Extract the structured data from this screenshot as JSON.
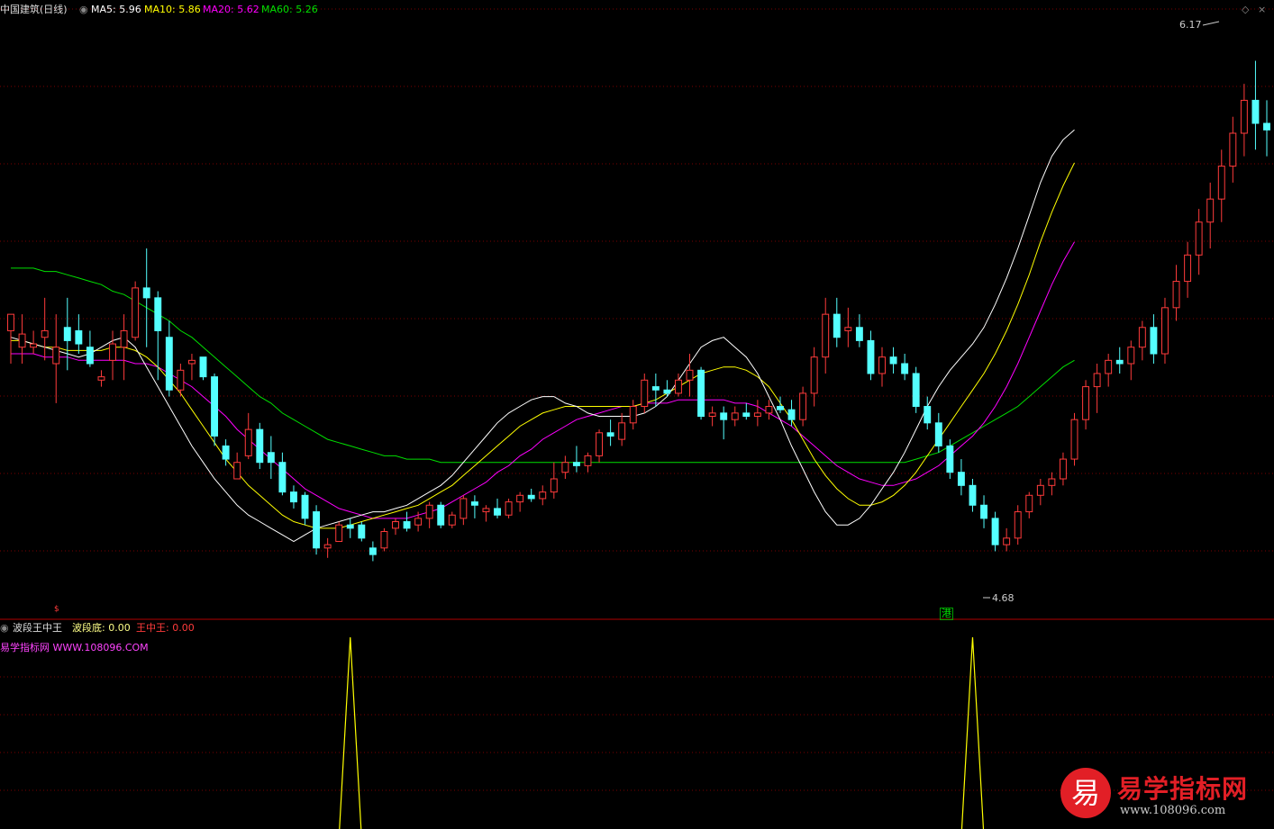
{
  "header": {
    "stock": "中国建筑(日线)",
    "ma5_label": "MA5:",
    "ma5_value": "5.96",
    "ma10_label": "MA10:",
    "ma10_value": "5.86",
    "ma20_label": "MA20:",
    "ma20_value": "5.62",
    "ma60_label": "MA60:",
    "ma60_value": "5.26"
  },
  "annotations": {
    "high": "6.17",
    "low": "4.68",
    "marker": "港"
  },
  "indicator": {
    "name": "波段王中王",
    "bottom_label": "波段底:",
    "bottom_value": "0.00",
    "king_label": "王中王:",
    "king_value": "0.00",
    "site": "易学指标网 WWW.108096.COM"
  },
  "watermark": {
    "logo": "易",
    "title": "易学指标网",
    "url": "www.108096.com"
  },
  "colors": {
    "up": "#ff3b3b",
    "down": "#54ffff",
    "ma5": "#ffffff",
    "ma10": "#ffff00",
    "ma20": "#ff00ff",
    "ma60": "#00e000",
    "grid": "#7a0000",
    "signal": "#ffff00"
  },
  "chart_data": {
    "type": "candlestick",
    "price_range": [
      4.55,
      6.3
    ],
    "grid": true,
    "candles": [
      {
        "o": 5.35,
        "h": 5.4,
        "l": 5.25,
        "c": 5.4
      },
      {
        "o": 5.3,
        "h": 5.4,
        "l": 5.25,
        "c": 5.34
      },
      {
        "o": 5.3,
        "h": 5.35,
        "l": 5.28,
        "c": 5.31
      },
      {
        "o": 5.33,
        "h": 5.45,
        "l": 5.26,
        "c": 5.35
      },
      {
        "o": 5.25,
        "h": 5.4,
        "l": 5.13,
        "c": 5.3
      },
      {
        "o": 5.36,
        "h": 5.45,
        "l": 5.23,
        "c": 5.32
      },
      {
        "o": 5.35,
        "h": 5.4,
        "l": 5.28,
        "c": 5.31
      },
      {
        "o": 5.3,
        "h": 5.35,
        "l": 5.24,
        "c": 5.25
      },
      {
        "o": 5.2,
        "h": 5.23,
        "l": 5.18,
        "c": 5.21
      },
      {
        "o": 5.26,
        "h": 5.35,
        "l": 5.2,
        "c": 5.31
      },
      {
        "o": 5.3,
        "h": 5.4,
        "l": 5.2,
        "c": 5.35
      },
      {
        "o": 5.33,
        "h": 5.5,
        "l": 5.32,
        "c": 5.48
      },
      {
        "o": 5.48,
        "h": 5.6,
        "l": 5.3,
        "c": 5.45
      },
      {
        "o": 5.45,
        "h": 5.47,
        "l": 5.2,
        "c": 5.35
      },
      {
        "o": 5.33,
        "h": 5.38,
        "l": 5.15,
        "c": 5.17
      },
      {
        "o": 5.17,
        "h": 5.25,
        "l": 5.15,
        "c": 5.23
      },
      {
        "o": 5.25,
        "h": 5.28,
        "l": 5.2,
        "c": 5.26
      },
      {
        "o": 5.27,
        "h": 5.27,
        "l": 5.2,
        "c": 5.21
      },
      {
        "o": 5.21,
        "h": 5.22,
        "l": 5,
        "c": 5.03
      },
      {
        "o": 5,
        "h": 5.02,
        "l": 4.94,
        "c": 4.96
      },
      {
        "o": 4.9,
        "h": 4.98,
        "l": 4.9,
        "c": 4.95
      },
      {
        "o": 4.97,
        "h": 5.1,
        "l": 4.96,
        "c": 5.05
      },
      {
        "o": 5.05,
        "h": 5.07,
        "l": 4.93,
        "c": 4.95
      },
      {
        "o": 4.98,
        "h": 5.03,
        "l": 4.9,
        "c": 4.95
      },
      {
        "o": 4.95,
        "h": 4.98,
        "l": 4.85,
        "c": 4.86
      },
      {
        "o": 4.86,
        "h": 4.88,
        "l": 4.81,
        "c": 4.83
      },
      {
        "o": 4.85,
        "h": 4.86,
        "l": 4.76,
        "c": 4.78
      },
      {
        "o": 4.8,
        "h": 4.82,
        "l": 4.67,
        "c": 4.69
      },
      {
        "o": 4.69,
        "h": 4.72,
        "l": 4.66,
        "c": 4.7
      },
      {
        "o": 4.71,
        "h": 4.77,
        "l": 4.71,
        "c": 4.76
      },
      {
        "o": 4.76,
        "h": 4.78,
        "l": 4.72,
        "c": 4.75
      },
      {
        "o": 4.76,
        "h": 4.77,
        "l": 4.71,
        "c": 4.72
      },
      {
        "o": 4.69,
        "h": 4.71,
        "l": 4.65,
        "c": 4.67
      },
      {
        "o": 4.69,
        "h": 4.75,
        "l": 4.68,
        "c": 4.74
      },
      {
        "o": 4.75,
        "h": 4.78,
        "l": 4.73,
        "c": 4.77
      },
      {
        "o": 4.77,
        "h": 4.8,
        "l": 4.74,
        "c": 4.75
      },
      {
        "o": 4.76,
        "h": 4.8,
        "l": 4.74,
        "c": 4.78
      },
      {
        "o": 4.78,
        "h": 4.83,
        "l": 4.75,
        "c": 4.82
      },
      {
        "o": 4.82,
        "h": 4.83,
        "l": 4.75,
        "c": 4.76
      },
      {
        "o": 4.76,
        "h": 4.8,
        "l": 4.75,
        "c": 4.79
      },
      {
        "o": 4.78,
        "h": 4.85,
        "l": 4.76,
        "c": 4.84
      },
      {
        "o": 4.83,
        "h": 4.85,
        "l": 4.78,
        "c": 4.82
      },
      {
        "o": 4.8,
        "h": 4.82,
        "l": 4.77,
        "c": 4.81
      },
      {
        "o": 4.81,
        "h": 4.84,
        "l": 4.78,
        "c": 4.79
      },
      {
        "o": 4.79,
        "h": 4.84,
        "l": 4.78,
        "c": 4.83
      },
      {
        "o": 4.83,
        "h": 4.86,
        "l": 4.8,
        "c": 4.85
      },
      {
        "o": 4.85,
        "h": 4.87,
        "l": 4.83,
        "c": 4.84
      },
      {
        "o": 4.84,
        "h": 4.88,
        "l": 4.82,
        "c": 4.86
      },
      {
        "o": 4.86,
        "h": 4.95,
        "l": 4.84,
        "c": 4.9
      },
      {
        "o": 4.92,
        "h": 4.97,
        "l": 4.9,
        "c": 4.95
      },
      {
        "o": 4.95,
        "h": 5,
        "l": 4.92,
        "c": 4.94
      },
      {
        "o": 4.94,
        "h": 4.98,
        "l": 4.92,
        "c": 4.97
      },
      {
        "o": 4.97,
        "h": 5.05,
        "l": 4.95,
        "c": 5.04
      },
      {
        "o": 5.04,
        "h": 5.08,
        "l": 5,
        "c": 5.03
      },
      {
        "o": 5.02,
        "h": 5.1,
        "l": 5,
        "c": 5.07
      },
      {
        "o": 5.07,
        "h": 5.14,
        "l": 5.05,
        "c": 5.12
      },
      {
        "o": 5.12,
        "h": 5.22,
        "l": 5.1,
        "c": 5.2
      },
      {
        "o": 5.18,
        "h": 5.22,
        "l": 5.12,
        "c": 5.17
      },
      {
        "o": 5.17,
        "h": 5.2,
        "l": 5.15,
        "c": 5.16
      },
      {
        "o": 5.16,
        "h": 5.22,
        "l": 5.15,
        "c": 5.2
      },
      {
        "o": 5.2,
        "h": 5.28,
        "l": 5.15,
        "c": 5.23
      },
      {
        "o": 5.23,
        "h": 5.24,
        "l": 5.08,
        "c": 5.09
      },
      {
        "o": 5.09,
        "h": 5.12,
        "l": 5.06,
        "c": 5.1
      },
      {
        "o": 5.1,
        "h": 5.12,
        "l": 5.02,
        "c": 5.08
      },
      {
        "o": 5.08,
        "h": 5.12,
        "l": 5.06,
        "c": 5.1
      },
      {
        "o": 5.1,
        "h": 5.13,
        "l": 5.08,
        "c": 5.09
      },
      {
        "o": 5.09,
        "h": 5.14,
        "l": 5.06,
        "c": 5.1
      },
      {
        "o": 5.1,
        "h": 5.14,
        "l": 5.08,
        "c": 5.12
      },
      {
        "o": 5.12,
        "h": 5.15,
        "l": 5.1,
        "c": 5.11
      },
      {
        "o": 5.11,
        "h": 5.14,
        "l": 5.06,
        "c": 5.08
      },
      {
        "o": 5.08,
        "h": 5.18,
        "l": 5.06,
        "c": 5.16
      },
      {
        "o": 5.16,
        "h": 5.3,
        "l": 5.12,
        "c": 5.27
      },
      {
        "o": 5.27,
        "h": 5.45,
        "l": 5.22,
        "c": 5.4
      },
      {
        "o": 5.4,
        "h": 5.45,
        "l": 5.3,
        "c": 5.33
      },
      {
        "o": 5.35,
        "h": 5.42,
        "l": 5.3,
        "c": 5.36
      },
      {
        "o": 5.36,
        "h": 5.4,
        "l": 5.3,
        "c": 5.32
      },
      {
        "o": 5.32,
        "h": 5.35,
        "l": 5.2,
        "c": 5.22
      },
      {
        "o": 5.22,
        "h": 5.3,
        "l": 5.18,
        "c": 5.27
      },
      {
        "o": 5.27,
        "h": 5.3,
        "l": 5.22,
        "c": 5.25
      },
      {
        "o": 5.25,
        "h": 5.28,
        "l": 5.2,
        "c": 5.22
      },
      {
        "o": 5.22,
        "h": 5.24,
        "l": 5.1,
        "c": 5.12
      },
      {
        "o": 5.12,
        "h": 5.15,
        "l": 5.05,
        "c": 5.07
      },
      {
        "o": 5.07,
        "h": 5.1,
        "l": 4.98,
        "c": 5.0
      },
      {
        "o": 5.0,
        "h": 5.02,
        "l": 4.9,
        "c": 4.92
      },
      {
        "o": 4.92,
        "h": 4.96,
        "l": 4.85,
        "c": 4.88
      },
      {
        "o": 4.88,
        "h": 4.9,
        "l": 4.8,
        "c": 4.82
      },
      {
        "o": 4.82,
        "h": 4.85,
        "l": 4.75,
        "c": 4.78
      },
      {
        "o": 4.78,
        "h": 4.8,
        "l": 4.68,
        "c": 4.7
      },
      {
        "o": 4.7,
        "h": 4.75,
        "l": 4.68,
        "c": 4.72
      },
      {
        "o": 4.72,
        "h": 4.82,
        "l": 4.7,
        "c": 4.8
      },
      {
        "o": 4.8,
        "h": 4.86,
        "l": 4.78,
        "c": 4.85
      },
      {
        "o": 4.85,
        "h": 4.9,
        "l": 4.82,
        "c": 4.88
      },
      {
        "o": 4.88,
        "h": 4.92,
        "l": 4.85,
        "c": 4.9
      },
      {
        "o": 4.9,
        "h": 4.98,
        "l": 4.88,
        "c": 4.96
      },
      {
        "o": 4.96,
        "h": 5.1,
        "l": 4.94,
        "c": 5.08
      },
      {
        "o": 5.08,
        "h": 5.2,
        "l": 5.05,
        "c": 5.18
      },
      {
        "o": 5.18,
        "h": 5.25,
        "l": 5.1,
        "c": 5.22
      },
      {
        "o": 5.22,
        "h": 5.28,
        "l": 5.18,
        "c": 5.26
      },
      {
        "o": 5.26,
        "h": 5.3,
        "l": 5.22,
        "c": 5.25
      },
      {
        "o": 5.25,
        "h": 5.32,
        "l": 5.2,
        "c": 5.3
      },
      {
        "o": 5.3,
        "h": 5.38,
        "l": 5.26,
        "c": 5.36
      },
      {
        "o": 5.36,
        "h": 5.4,
        "l": 5.25,
        "c": 5.28
      },
      {
        "o": 5.28,
        "h": 5.45,
        "l": 5.25,
        "c": 5.42
      },
      {
        "o": 5.42,
        "h": 5.55,
        "l": 5.38,
        "c": 5.5
      },
      {
        "o": 5.5,
        "h": 5.62,
        "l": 5.45,
        "c": 5.58
      },
      {
        "o": 5.58,
        "h": 5.72,
        "l": 5.52,
        "c": 5.68
      },
      {
        "o": 5.68,
        "h": 5.8,
        "l": 5.6,
        "c": 5.75
      },
      {
        "o": 5.75,
        "h": 5.9,
        "l": 5.68,
        "c": 5.85
      },
      {
        "o": 5.85,
        "h": 6.0,
        "l": 5.8,
        "c": 5.95
      },
      {
        "o": 5.95,
        "h": 6.1,
        "l": 5.88,
        "c": 6.05
      },
      {
        "o": 6.05,
        "h": 6.17,
        "l": 5.9,
        "c": 5.98
      },
      {
        "o": 5.98,
        "h": 6.05,
        "l": 5.88,
        "c": 5.96
      }
    ],
    "ma5": [
      5.33,
      5.32,
      5.31,
      5.3,
      5.29,
      5.28,
      5.27,
      5.28,
      5.3,
      5.32,
      5.33,
      5.3,
      5.24,
      5.18,
      5.12,
      5.06,
      5.0,
      4.95,
      4.9,
      4.86,
      4.82,
      4.79,
      4.77,
      4.75,
      4.73,
      4.71,
      4.73,
      4.75,
      4.76,
      4.77,
      4.78,
      4.79,
      4.8,
      4.8,
      4.81,
      4.82,
      4.84,
      4.86,
      4.88,
      4.91,
      4.95,
      4.99,
      5.03,
      5.07,
      5.1,
      5.12,
      5.14,
      5.15,
      5.15,
      5.13,
      5.12,
      5.1,
      5.09,
      5.09,
      5.09,
      5.09,
      5.1,
      5.12,
      5.15,
      5.2,
      5.25,
      5.3,
      5.32,
      5.33,
      5.3,
      5.27,
      5.22,
      5.15,
      5.08,
      5.0,
      4.93,
      4.86,
      4.8,
      4.76,
      4.76,
      4.78,
      4.82,
      4.87,
      4.92,
      4.98,
      5.05,
      5.12,
      5.18,
      5.23,
      5.27,
      5.31,
      5.36,
      5.43,
      5.51,
      5.6,
      5.7,
      5.8,
      5.88,
      5.93,
      5.96
    ],
    "ma10": [
      5.32,
      5.32,
      5.31,
      5.3,
      5.3,
      5.29,
      5.29,
      5.29,
      5.29,
      5.3,
      5.3,
      5.29,
      5.27,
      5.24,
      5.2,
      5.16,
      5.11,
      5.06,
      5.01,
      4.96,
      4.92,
      4.88,
      4.85,
      4.82,
      4.79,
      4.77,
      4.76,
      4.75,
      4.75,
      4.75,
      4.76,
      4.77,
      4.78,
      4.79,
      4.8,
      4.81,
      4.82,
      4.84,
      4.86,
      4.88,
      4.91,
      4.94,
      4.97,
      5.0,
      5.03,
      5.06,
      5.08,
      5.1,
      5.11,
      5.12,
      5.12,
      5.12,
      5.12,
      5.12,
      5.12,
      5.12,
      5.13,
      5.14,
      5.16,
      5.18,
      5.2,
      5.22,
      5.23,
      5.24,
      5.24,
      5.23,
      5.21,
      5.18,
      5.13,
      5.08,
      5.02,
      4.96,
      4.91,
      4.87,
      4.84,
      4.82,
      4.82,
      4.83,
      4.85,
      4.88,
      4.92,
      4.97,
      5.02,
      5.07,
      5.12,
      5.17,
      5.22,
      5.28,
      5.35,
      5.43,
      5.52,
      5.62,
      5.71,
      5.79,
      5.86
    ],
    "ma20": [
      5.28,
      5.28,
      5.28,
      5.27,
      5.27,
      5.27,
      5.26,
      5.26,
      5.26,
      5.26,
      5.26,
      5.25,
      5.25,
      5.24,
      5.22,
      5.2,
      5.18,
      5.15,
      5.12,
      5.09,
      5.05,
      5.02,
      4.99,
      4.96,
      4.93,
      4.9,
      4.87,
      4.85,
      4.83,
      4.81,
      4.8,
      4.79,
      4.78,
      4.78,
      4.78,
      4.78,
      4.79,
      4.8,
      4.81,
      4.83,
      4.85,
      4.87,
      4.89,
      4.92,
      4.94,
      4.97,
      4.99,
      5.02,
      5.04,
      5.06,
      5.08,
      5.09,
      5.1,
      5.11,
      5.12,
      5.12,
      5.13,
      5.13,
      5.13,
      5.14,
      5.14,
      5.14,
      5.14,
      5.14,
      5.13,
      5.13,
      5.12,
      5.1,
      5.08,
      5.06,
      5.03,
      5.0,
      4.97,
      4.94,
      4.92,
      4.9,
      4.89,
      4.88,
      4.88,
      4.89,
      4.9,
      4.92,
      4.94,
      4.97,
      5.0,
      5.03,
      5.07,
      5.12,
      5.18,
      5.25,
      5.33,
      5.41,
      5.49,
      5.56,
      5.62
    ],
    "ma60": [
      5.54,
      5.54,
      5.54,
      5.53,
      5.53,
      5.52,
      5.51,
      5.5,
      5.49,
      5.47,
      5.46,
      5.44,
      5.42,
      5.4,
      5.38,
      5.35,
      5.33,
      5.3,
      5.27,
      5.24,
      5.21,
      5.18,
      5.15,
      5.13,
      5.1,
      5.08,
      5.06,
      5.04,
      5.02,
      5.01,
      5.0,
      4.99,
      4.98,
      4.97,
      4.97,
      4.96,
      4.96,
      4.96,
      4.95,
      4.95,
      4.95,
      4.95,
      4.95,
      4.95,
      4.95,
      4.95,
      4.95,
      4.95,
      4.95,
      4.95,
      4.95,
      4.95,
      4.95,
      4.95,
      4.95,
      4.95,
      4.95,
      4.95,
      4.95,
      4.95,
      4.95,
      4.95,
      4.95,
      4.95,
      4.95,
      4.95,
      4.95,
      4.95,
      4.95,
      4.95,
      4.95,
      4.95,
      4.95,
      4.95,
      4.95,
      4.95,
      4.95,
      4.95,
      4.95,
      4.95,
      4.96,
      4.97,
      4.98,
      5.0,
      5.02,
      5.04,
      5.06,
      5.08,
      5.1,
      5.12,
      5.15,
      5.18,
      5.21,
      5.24,
      5.26
    ],
    "signals": [
      30,
      85
    ]
  }
}
